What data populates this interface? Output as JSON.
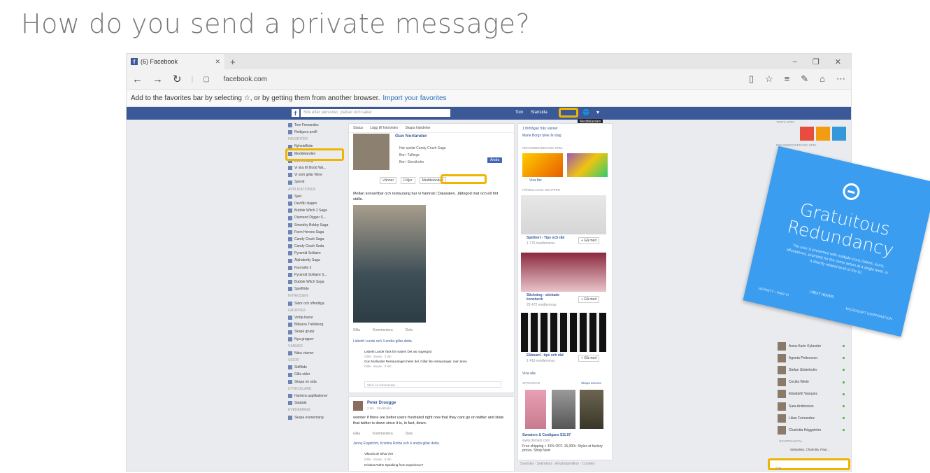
{
  "slide": {
    "title": "How do you send a private message?"
  },
  "browser": {
    "tab_title": "(6) Facebook",
    "url": "facebook.com",
    "fav_text": "Add to the favorites bar by selecting ☆, or by getting them from another browser.",
    "fav_link": "Import your favorites"
  },
  "fb": {
    "search_placeholder": "Sök efter personer, platser och saker",
    "user_name": "Tom",
    "home": "Startsida",
    "tooltip": "Meddelanden",
    "left_nav": [
      {
        "label": "Tom Fernandez",
        "type": "item"
      },
      {
        "label": "Redigera profil",
        "type": "item"
      },
      {
        "label": "FAVORITER",
        "type": "section"
      },
      {
        "label": "Nyhetsflöde",
        "type": "item"
      },
      {
        "label": "Meddelanden",
        "type": "item"
      },
      {
        "label": "Evenemang",
        "type": "item"
      },
      {
        "label": "Vi ska till Bodd Wa...",
        "type": "item"
      },
      {
        "label": "Vi som gillar Wine",
        "type": "item"
      },
      {
        "label": "Spend",
        "type": "item"
      },
      {
        "label": "APPLIKATIONER",
        "type": "section"
      },
      {
        "label": "Spel",
        "type": "item"
      },
      {
        "label": "Dev/får slagen",
        "type": "item"
      },
      {
        "label": "Bubble Witch 2 Saga",
        "type": "item"
      },
      {
        "label": "Diamond Digger S...",
        "type": "item"
      },
      {
        "label": "Smoothy Bobby Saga",
        "type": "item"
      },
      {
        "label": "Farm Heroes Saga",
        "type": "item"
      },
      {
        "label": "Candy Crush Saga",
        "type": "item"
      },
      {
        "label": "Candy Crush Soda",
        "type": "item"
      },
      {
        "label": "Pyramid Solitaire",
        "type": "item"
      },
      {
        "label": "Alphabetty Saga",
        "type": "item"
      },
      {
        "label": "Farmville 2",
        "type": "item"
      },
      {
        "label": "Pyramid Solitaire S...",
        "type": "item"
      },
      {
        "label": "Bubble Witch Saga",
        "type": "item"
      },
      {
        "label": "Spelflöde",
        "type": "item"
      },
      {
        "label": "INTRESSEN",
        "type": "section"
      },
      {
        "label": "Sidor och offentliga",
        "type": "item"
      },
      {
        "label": "GRUPPER",
        "type": "section"
      },
      {
        "label": "Vintip-bazar",
        "type": "item"
      },
      {
        "label": "Bilkarva Trelleborg",
        "type": "item"
      },
      {
        "label": "Skapa grupp",
        "type": "item"
      },
      {
        "label": "Nya grupper",
        "type": "item"
      },
      {
        "label": "VÄNNER",
        "type": "section"
      },
      {
        "label": "Nära vänner",
        "type": "item"
      },
      {
        "label": "SIDOR",
        "type": "section"
      },
      {
        "label": "Sidflöde",
        "type": "item"
      },
      {
        "label": "Gilla sidor",
        "type": "item"
      },
      {
        "label": "Skapa en sida",
        "type": "item"
      },
      {
        "label": "UTVECKLARE",
        "type": "section"
      },
      {
        "label": "Hantera applikationer",
        "type": "item"
      },
      {
        "label": "Statistik",
        "type": "item"
      },
      {
        "label": "EVENEMANG",
        "type": "section"
      },
      {
        "label": "Skapa evenemang",
        "type": "item"
      }
    ],
    "post": {
      "tabs": [
        "Status",
        "Lägg till foto/video",
        "Skapa händelse"
      ],
      "name": "Gun Norlander",
      "lines": [
        "Har spelat Candy Crush Saga",
        "Bor i Tullinge",
        "Bor i Stockholm"
      ],
      "add_friend": "Ändra",
      "btn_friends": "Vänner",
      "btn_follow": "Följer",
      "btn_message": "Meddelanden",
      "text": "Mellan konsertbar och restaurang har vi hamnat i Dalasalen. Jättegod mat och ett fint ställe.",
      "like": "Gilla",
      "comment": "Kommentera",
      "share": "Dela",
      "likes": "Lisbeth Lunde och 3 andra gillar detta.",
      "c1": "Lisbeth Lunde Tack för maten! Det var supergott",
      "c2": "Gun Norlander Restaurangen heter del. Gillar lite restauranger, men ännu",
      "c_meta": "Gilla · Svara · 2 tim",
      "write": "Skriv en kommentar..."
    },
    "post2": {
      "name": "Peter Drougge",
      "meta": "2 tim · Stockholm",
      "text": "wonder if there are better users frustrated right now that they cant go on twitter and state that twitter is down since it is, in fact, down.",
      "likes": "Jenny Engström, Kristina Rothe och 4 andra gillar detta.",
      "c1": "Viktoria de Silva Vier",
      "c2": "Kristina Rothe Speaking from experience?"
    },
    "side": {
      "requests": [
        "1 förfrågan från vänner",
        "Marie Borgs fyller år idag"
      ],
      "games_header": "REKOMMENDERADE SPEL",
      "see_more": "Visa fler",
      "groups_header": "FÖRESLAGNA GRUPPER",
      "groups": [
        {
          "name": "Spelbort - Tips och råd",
          "members": "1 776 medlemmar",
          "btn": "+ Gå med"
        },
        {
          "name": "Stickning - stickade konstverk",
          "members": "25 472 medlemmar",
          "btn": "+ Gå med"
        },
        {
          "name": "Ekboard - tips och råd",
          "members": "1 416 medlemmar",
          "btn": "+ Gå med"
        }
      ],
      "see_all": "Visa alla",
      "sponsored": "SPONSRAD",
      "create_ad": "Skapa annons",
      "ad_title": "Sweaters & Cardigans $11.97",
      "ad_site": "www.domain.com",
      "ad_text": "Free shipping + 15% OFF. 15,000+ Styles at factory prices. Shop Now!",
      "footer": "Svenska · Sekretess · Användarvillkor · Cookies"
    },
    "chat": {
      "header": "TOM'S SPEL",
      "header2": "REKOMMENDERADE SPEL",
      "contacts": [
        "Anna-Karin Kylander",
        "Agneta Pettersson",
        "Stefan Söderholm",
        "Cecilia Wiele",
        "Elisabeth Vasquez",
        "Sara Andersson",
        "Lilian Fernandez",
        "Charlotta Häggström"
      ],
      "groups_header": "GRUPPSAMTAL",
      "group_name": "Sebastian, Charlotta, Paul...",
      "search_placeholder": "Sök"
    }
  },
  "overlay": {
    "title_line1": "Gratuitous",
    "title_line2": "Redundancy",
    "body": "The user is presented with multiple icons (labels, icons, affordances, prompts) for the same action at a single level, or a directly related level of the UI.",
    "link": "| NEXT HOVER",
    "foot_left": "AFFINITY • PAIR VI",
    "foot_right": "MICROSOFT CORPORATION"
  }
}
